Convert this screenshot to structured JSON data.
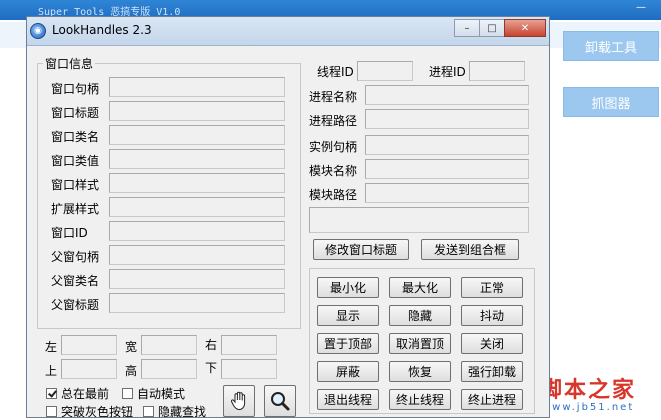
{
  "parent": {
    "title": "Super Tools 恶搞专版 V1.0",
    "min_glyph": "—",
    "buttons": {
      "uninstall": "卸载工具",
      "grab": "抓图器"
    }
  },
  "watermark": {
    "main": "脚本之家",
    "sub": "www.jb51.net"
  },
  "window": {
    "title": "LookHandles 2.3",
    "icon_glyph": "◉",
    "controls": {
      "min": "–",
      "max": "□",
      "close": "✕"
    }
  },
  "window_info": {
    "legend": "窗口信息",
    "rows": [
      "窗口句柄",
      "窗口标题",
      "窗口类名",
      "窗口类值",
      "窗口样式",
      "扩展样式",
      "窗口ID",
      "父窗句柄",
      "父窗类名",
      "父窗标题"
    ]
  },
  "position": {
    "left": "左",
    "width": "宽",
    "right": "右",
    "top": "上",
    "height": "高",
    "bottom": "下"
  },
  "options": {
    "always_on_top": {
      "label": "总在最前",
      "checked": true
    },
    "auto_mode": {
      "label": "自动模式",
      "checked": false
    },
    "break_gray": {
      "label": "突破灰色按钮",
      "checked": false
    },
    "hidden_find": {
      "label": "隐藏查找",
      "checked": false
    }
  },
  "process_info": {
    "thread_id": "线程ID",
    "process_id": "进程ID",
    "rows": [
      "进程名称",
      "进程路径",
      "实例句柄",
      "模块名称",
      "模块路径"
    ]
  },
  "actions": {
    "modify_title": "修改窗口标题",
    "send_to_combo": "发送到组合框"
  },
  "grid_buttons": [
    [
      "最小化",
      "最大化",
      "正常"
    ],
    [
      "显示",
      "隐藏",
      "抖动"
    ],
    [
      "置于顶部",
      "取消置顶",
      "关闭"
    ],
    [
      "屏蔽",
      "恢复",
      "强行卸载"
    ],
    [
      "退出线程",
      "终止线程",
      "终止进程"
    ]
  ]
}
